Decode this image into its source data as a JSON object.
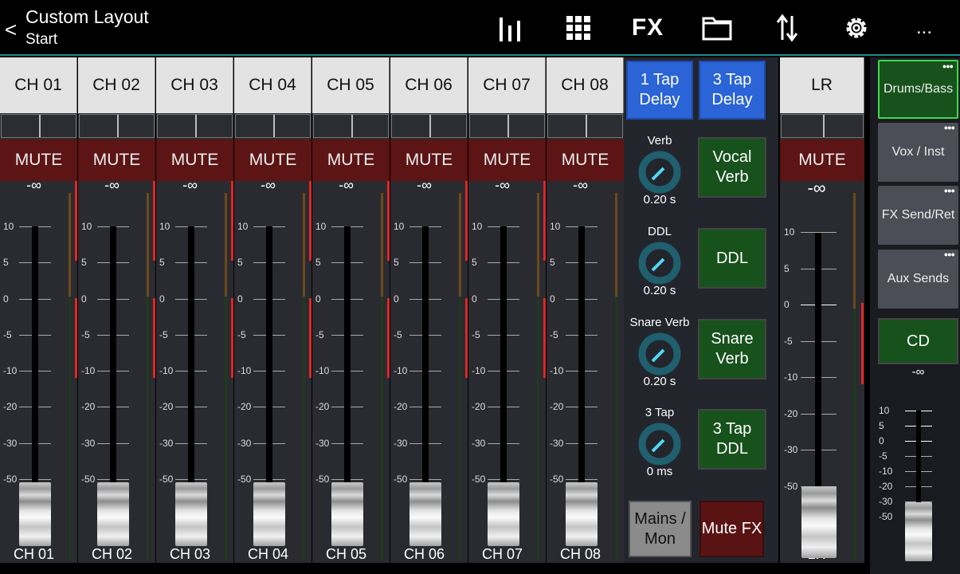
{
  "header": {
    "back": "<",
    "title": "Custom Layout",
    "subtitle": "Start",
    "fx_label": "FX",
    "more": "..."
  },
  "scale_labels": [
    "10",
    "5",
    "0",
    "-5",
    "-10",
    "-20",
    "-30",
    "-50"
  ],
  "channels": [
    {
      "name": "CH 01",
      "mute": "MUTE",
      "level": "-∞",
      "footer": "CH 01"
    },
    {
      "name": "CH 02",
      "mute": "MUTE",
      "level": "-∞",
      "footer": "CH 02"
    },
    {
      "name": "CH 03",
      "mute": "MUTE",
      "level": "-∞",
      "footer": "CH 03"
    },
    {
      "name": "CH 04",
      "mute": "MUTE",
      "level": "-∞",
      "footer": "CH 04"
    },
    {
      "name": "CH 05",
      "mute": "MUTE",
      "level": "-∞",
      "footer": "CH 05"
    },
    {
      "name": "CH 06",
      "mute": "MUTE",
      "level": "-∞",
      "footer": "CH 06"
    },
    {
      "name": "CH 07",
      "mute": "MUTE",
      "level": "-∞",
      "footer": "CH 07"
    },
    {
      "name": "CH 08",
      "mute": "MUTE",
      "level": "-∞",
      "footer": "CH 08"
    }
  ],
  "fx": {
    "tap1": "1 Tap Delay",
    "tap3": "3 Tap Delay",
    "knobs": [
      {
        "label": "Verb",
        "value": "0.20 s",
        "button": "Vocal Verb"
      },
      {
        "label": "DDL",
        "value": "0.20 s",
        "button": "DDL"
      },
      {
        "label": "Snare Verb",
        "value": "0.20 s",
        "button": "Snare Verb"
      },
      {
        "label": "3 Tap",
        "value": "0 ms",
        "button": "3 Tap DDL"
      }
    ],
    "mains_mon": "Mains / Mon",
    "mute_fx": "Mute FX"
  },
  "lr": {
    "name": "LR",
    "mute": "MUTE",
    "level": "-∞",
    "footer": "LR"
  },
  "layers": [
    {
      "label": "Drums/Bass",
      "selected": true
    },
    {
      "label": "Vox / Inst",
      "selected": false
    },
    {
      "label": "FX Send/Ret",
      "selected": false
    },
    {
      "label": "Aux Sends",
      "selected": false
    }
  ],
  "cd": {
    "label": "CD",
    "level": "-∞"
  },
  "colors": {
    "mute": "#5c1414",
    "accent": "#1a8f8f",
    "blue": "#2a64d6",
    "green": "#17521c",
    "meter_red": "#e02626"
  }
}
